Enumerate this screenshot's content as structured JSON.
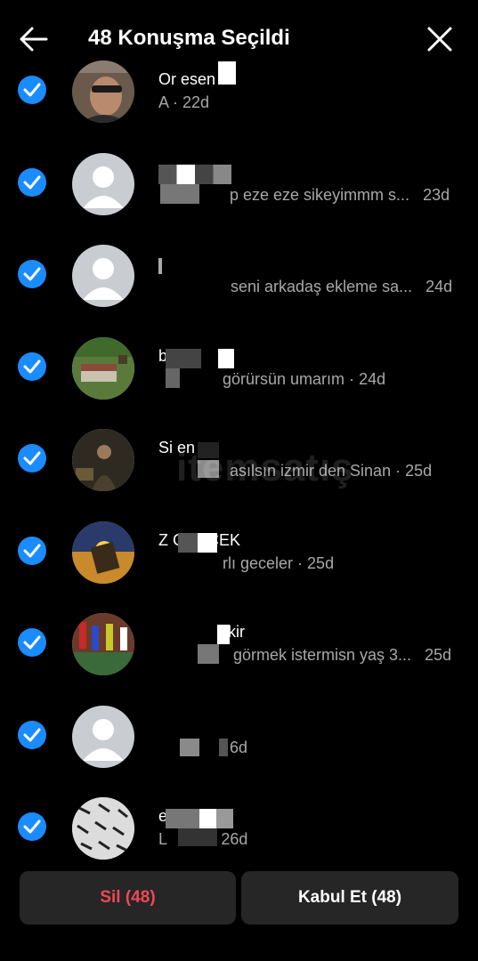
{
  "header": {
    "title": "48 Konuşma Seçildi"
  },
  "conversations": [
    {
      "name": "Or      esen",
      "preview": "A          ",
      "time": "· 22d"
    },
    {
      "name": "",
      "preview": "p eze eze sikeyimmm s...",
      "time": "23d"
    },
    {
      "name": "",
      "preview": "seni arkadaş ekleme sa...",
      "time": "24d"
    },
    {
      "name": "b",
      "preview": "görürsün umarım",
      "time": "· 24d"
    },
    {
      "name": "Si         en",
      "preview": "asılsın izmir den Sinan",
      "time": "· 25d"
    },
    {
      "name": "Z          GERÇEK",
      "preview": "rlı geceler",
      "time": "· 25d"
    },
    {
      "name": "kir",
      "preview": "görmek istermisn yaş 3...",
      "time": "25d"
    },
    {
      "name": "",
      "preview": "",
      "time": "6d"
    },
    {
      "name": "e             im",
      "preview": "L",
      "time": "26d"
    }
  ],
  "actions": {
    "delete_label": "Sil (48)",
    "accept_label": "Kabul Et (48)"
  },
  "watermark": "itemsatış",
  "colors": {
    "background": "#000000",
    "check": "#1a8cff",
    "delete": "#ed4956",
    "button_bg": "#262626",
    "secondary_text": "#a8a8a8"
  }
}
